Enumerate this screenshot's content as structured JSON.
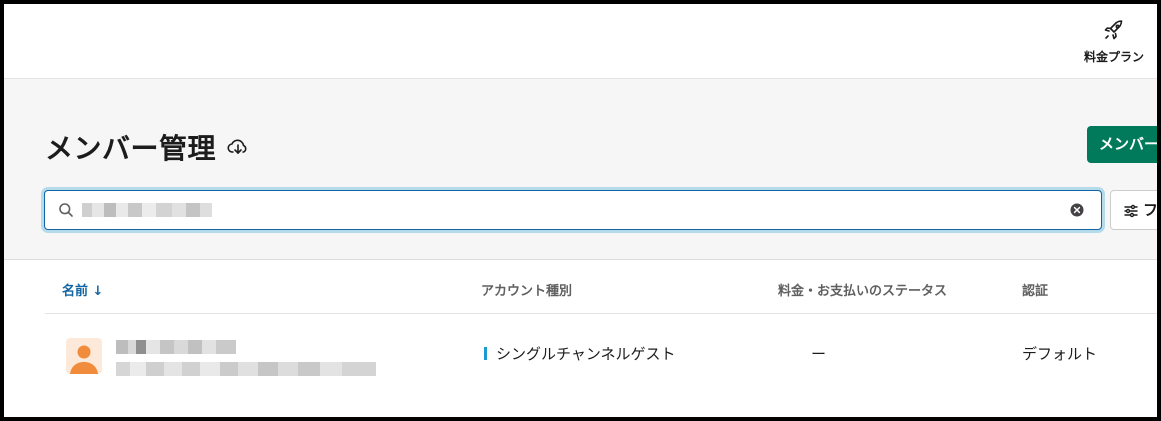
{
  "topbar": {
    "upgrade_label": "料金プラン",
    "upgrade_icon": "rocket-icon"
  },
  "header": {
    "title": "メンバー管理",
    "download_icon": "cloud-download-icon",
    "primary_button_label": "メンバー",
    "search": {
      "value": "██████████",
      "icon": "search-icon",
      "clear_icon": "clear-circle-icon"
    },
    "filter_button_label": "フ",
    "filter_icon": "sliders-icon"
  },
  "table": {
    "columns": {
      "name": "名前 ↓",
      "account_type": "アカウント種別",
      "billing_status": "料金・お支払いのステータス",
      "auth": "認証"
    },
    "rows": [
      {
        "name": "████████",
        "email": "████████████████████",
        "account_type": "シングルチャンネルゲスト",
        "billing_status": "ー",
        "auth": "デフォルト"
      }
    ]
  },
  "colors": {
    "primary": "#007a5a",
    "link": "#1264a3",
    "focus": "#1d9bd1",
    "avatar_bg": "#fde9d9",
    "avatar_fg": "#f08c3c"
  }
}
